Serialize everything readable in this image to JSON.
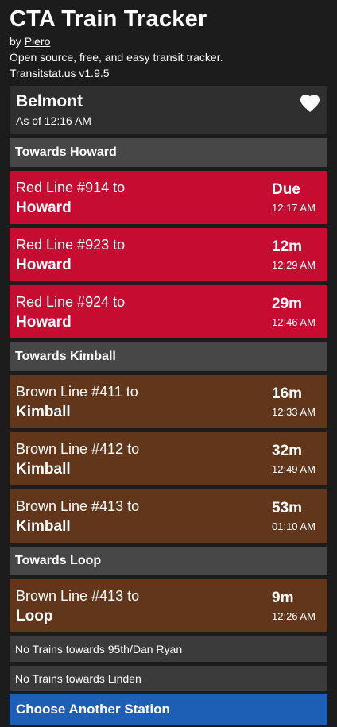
{
  "header": {
    "title": "CTA Train Tracker",
    "by_prefix": "by",
    "author": "Piero",
    "tagline": "Open source, free, and easy transit tracker.",
    "version": "Transitstat.us v1.9.5"
  },
  "station": {
    "name": "Belmont",
    "as_of": "As of 12:16 AM",
    "favorite_icon": "heart-icon"
  },
  "sections": [
    {
      "title": "Towards Howard",
      "trains": [
        {
          "line": "Red Line #914 to",
          "destination": "Howard",
          "eta": "Due",
          "time": "12:17 AM",
          "color": "#c60c30"
        },
        {
          "line": "Red Line #923 to",
          "destination": "Howard",
          "eta": "12m",
          "time": "12:29 AM",
          "color": "#c60c30"
        },
        {
          "line": "Red Line #924 to",
          "destination": "Howard",
          "eta": "29m",
          "time": "12:46 AM",
          "color": "#c60c30"
        }
      ]
    },
    {
      "title": "Towards Kimball",
      "trains": [
        {
          "line": "Brown Line #411 to",
          "destination": "Kimball",
          "eta": "16m",
          "time": "12:33 AM",
          "color": "#62361b"
        },
        {
          "line": "Brown Line #412 to",
          "destination": "Kimball",
          "eta": "32m",
          "time": "12:49 AM",
          "color": "#62361b"
        },
        {
          "line": "Brown Line #413 to",
          "destination": "Kimball",
          "eta": "53m",
          "time": "01:10 AM",
          "color": "#62361b"
        }
      ]
    },
    {
      "title": "Towards Loop",
      "trains": [
        {
          "line": "Brown Line #413 to",
          "destination": "Loop",
          "eta": "9m",
          "time": "12:26 AM",
          "color": "#62361b"
        }
      ]
    }
  ],
  "no_trains": [
    "No Trains towards 95th/Dan Ryan",
    "No Trains towards Linden"
  ],
  "choose_station_label": "Choose Another Station",
  "colors": {
    "background": "#1c1c1c",
    "red_line": "#c60c30",
    "brown_line": "#62361b",
    "button": "#1d5fb5"
  }
}
